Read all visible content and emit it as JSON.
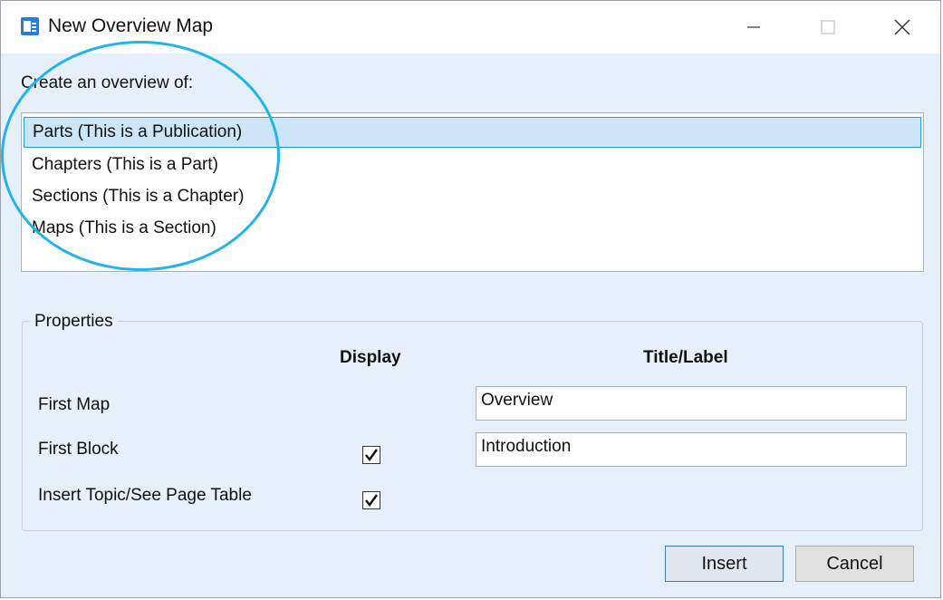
{
  "window": {
    "title": "New Overview Map",
    "icon": "document-app-icon"
  },
  "prompt": "Create an overview of:",
  "overview_options": [
    {
      "label": "Parts (This is a Publication)",
      "selected": true
    },
    {
      "label": "Chapters (This is a Part)",
      "selected": false
    },
    {
      "label": "Sections (This is a Chapter)",
      "selected": false
    },
    {
      "label": "Maps (This is a Section)",
      "selected": false
    }
  ],
  "properties": {
    "group_label": "Properties",
    "col_display": "Display",
    "col_title": "Title/Label",
    "rows": [
      {
        "label": "First Map",
        "has_checkbox": false,
        "checked": false,
        "title_value": "Overview"
      },
      {
        "label": "First Block",
        "has_checkbox": true,
        "checked": true,
        "title_value": "Introduction"
      },
      {
        "label": "Insert Topic/See Page Table",
        "has_checkbox": true,
        "checked": true,
        "title_value": null
      }
    ]
  },
  "buttons": {
    "insert": "Insert",
    "cancel": "Cancel"
  },
  "colors": {
    "dialog_bg": "#e6f0fb",
    "selection_bg": "#cde6f7",
    "selection_border": "#26a0da",
    "annotation_circle": "#23b3e6"
  }
}
